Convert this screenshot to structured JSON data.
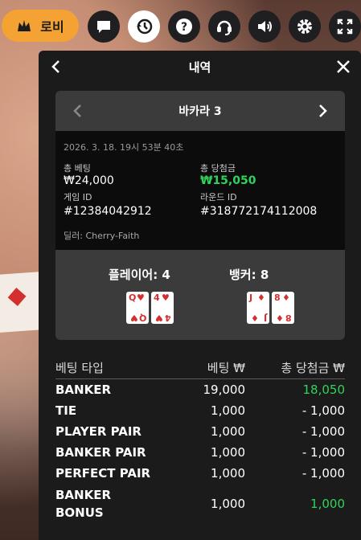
{
  "toolbar": {
    "lobby_label": "로비",
    "icons": [
      "crown-icon",
      "chat-icon",
      "history-icon",
      "help-icon",
      "support-icon",
      "volume-icon",
      "settings-icon",
      "fullscreen-icon"
    ]
  },
  "panel": {
    "title": "내역",
    "game": {
      "name": "바카라 3",
      "datetime": "2026. 3. 18. 19시 53분 40초",
      "total_bet_label": "총 베팅",
      "total_bet_value": "₩24,000",
      "total_win_label": "총 당첨금",
      "total_win_value": "₩15,050",
      "game_id_label": "게임 ID",
      "game_id_value": "#12384042912",
      "round_id_label": "라운드 ID",
      "round_id_value": "#318772174112008",
      "dealer": "딜러: Cherry-Faith"
    },
    "result": {
      "player_label": "플레이어: 4",
      "banker_label": "뱅커: 8",
      "player_cards": [
        {
          "rank": "Q",
          "suit": "♥"
        },
        {
          "rank": "4",
          "suit": "♥"
        }
      ],
      "banker_cards": [
        {
          "rank": "J",
          "suit": "♦"
        },
        {
          "rank": "8",
          "suit": "♦"
        }
      ]
    },
    "bets": {
      "headers": {
        "type": "베팅 타입",
        "bet": "베팅 ₩",
        "win": "총 당첨금 ₩"
      },
      "rows": [
        {
          "type": "BANKER",
          "bet": "19,000",
          "win": "18,050",
          "win_positive": true
        },
        {
          "type": "TIE",
          "bet": "1,000",
          "win": "- 1,000",
          "win_positive": false
        },
        {
          "type": "PLAYER PAIR",
          "bet": "1,000",
          "win": "- 1,000",
          "win_positive": false
        },
        {
          "type": "BANKER PAIR",
          "bet": "1,000",
          "win": "- 1,000",
          "win_positive": false
        },
        {
          "type": "PERFECT PAIR",
          "bet": "1,000",
          "win": "- 1,000",
          "win_positive": false
        },
        {
          "type": "BANKER BONUS",
          "bet": "1,000",
          "win": "1,000",
          "win_positive": true
        }
      ]
    }
  },
  "colors": {
    "accent": "#f3a233",
    "win": "#2fd35b",
    "panel": "#1b1b1b",
    "card_suit": "#d32f2f"
  }
}
